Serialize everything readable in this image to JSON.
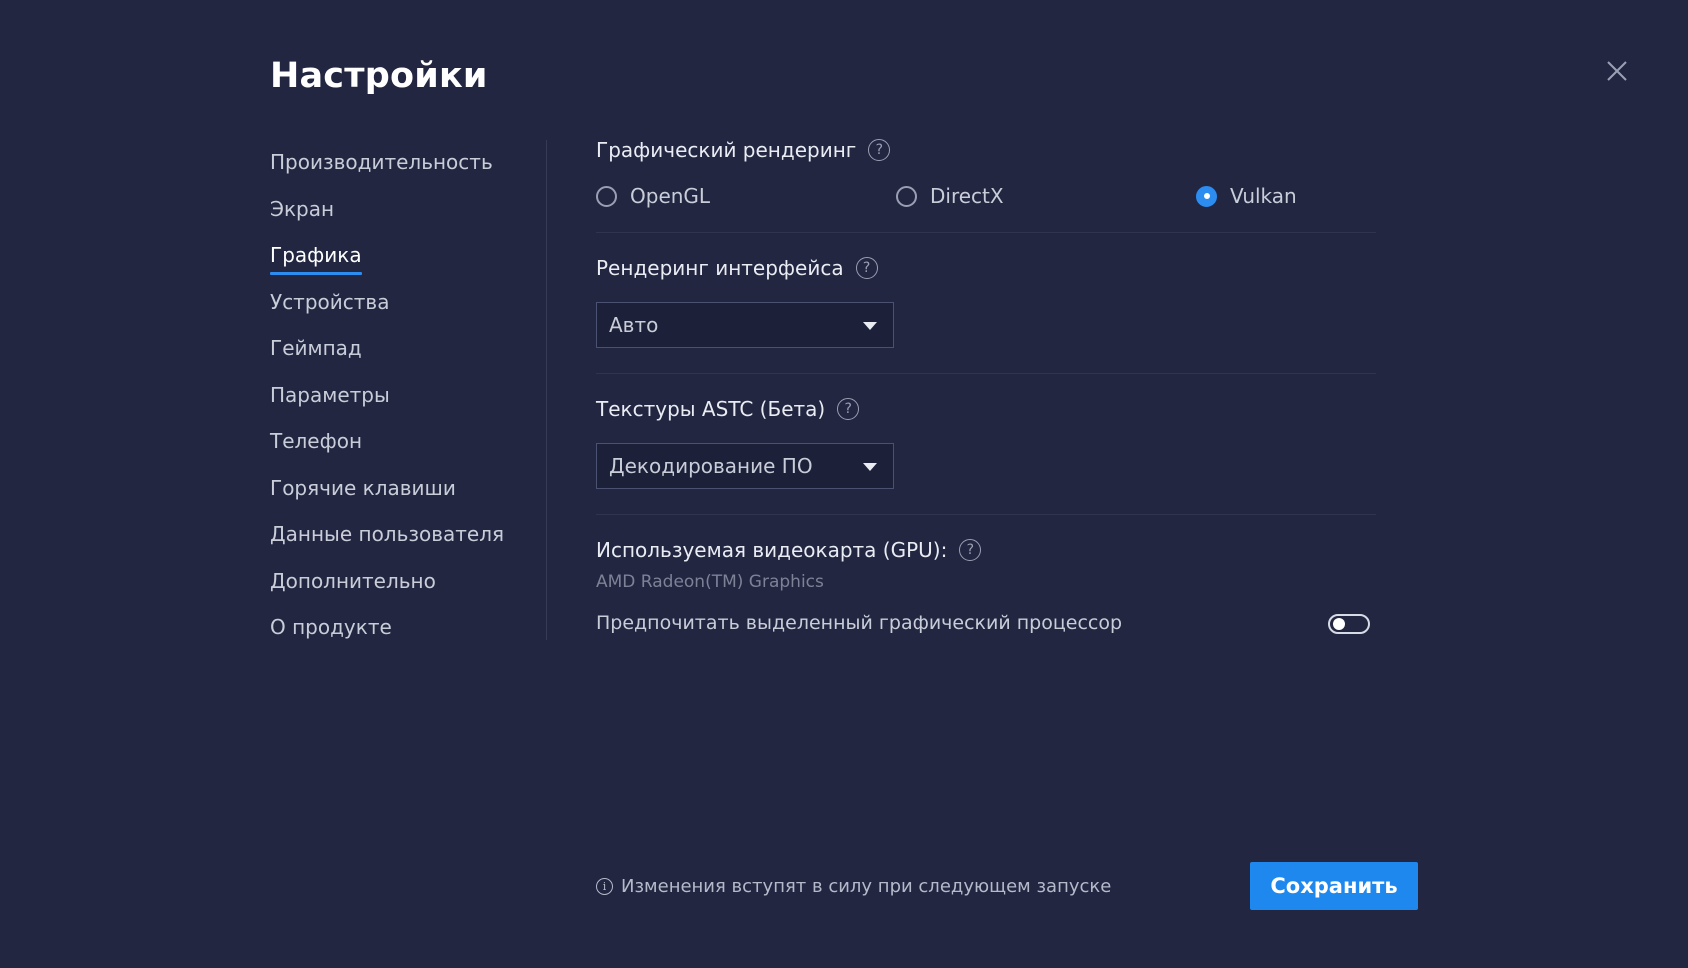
{
  "header": {
    "title": "Настройки",
    "close_icon": "close-icon"
  },
  "sidebar": {
    "active_index": 2,
    "items": [
      {
        "label": "Производительность"
      },
      {
        "label": "Экран"
      },
      {
        "label": "Графика"
      },
      {
        "label": "Устройства"
      },
      {
        "label": "Геймпад"
      },
      {
        "label": "Параметры"
      },
      {
        "label": "Телефон"
      },
      {
        "label": "Горячие клавиши"
      },
      {
        "label": "Данные пользователя"
      },
      {
        "label": "Дополнительно"
      },
      {
        "label": "О продукте"
      }
    ]
  },
  "graphics_rendering": {
    "title": "Графический рендеринг",
    "help_icon": "question-icon",
    "options": [
      {
        "label": "OpenGL",
        "checked": false
      },
      {
        "label": "DirectX",
        "checked": false
      },
      {
        "label": "Vulkan",
        "checked": true
      }
    ]
  },
  "ui_rendering": {
    "title": "Рендеринг интерфейса",
    "selected": "Авто"
  },
  "astc_textures": {
    "title": "Текстуры ASTC (Бета)",
    "selected": "Декодирование ПО"
  },
  "gpu": {
    "title": "Используемая видеокарта (GPU):",
    "name": "AMD Radeon(TM) Graphics",
    "prefer_dedicated_label": "Предпочитать выделенный графический процессор",
    "prefer_dedicated_enabled": false
  },
  "footer": {
    "note": "Изменения вступят в силу при следующем запуске",
    "save_label": "Сохранить"
  },
  "colors": {
    "background": "#222640",
    "accent": "#1e88ef"
  }
}
